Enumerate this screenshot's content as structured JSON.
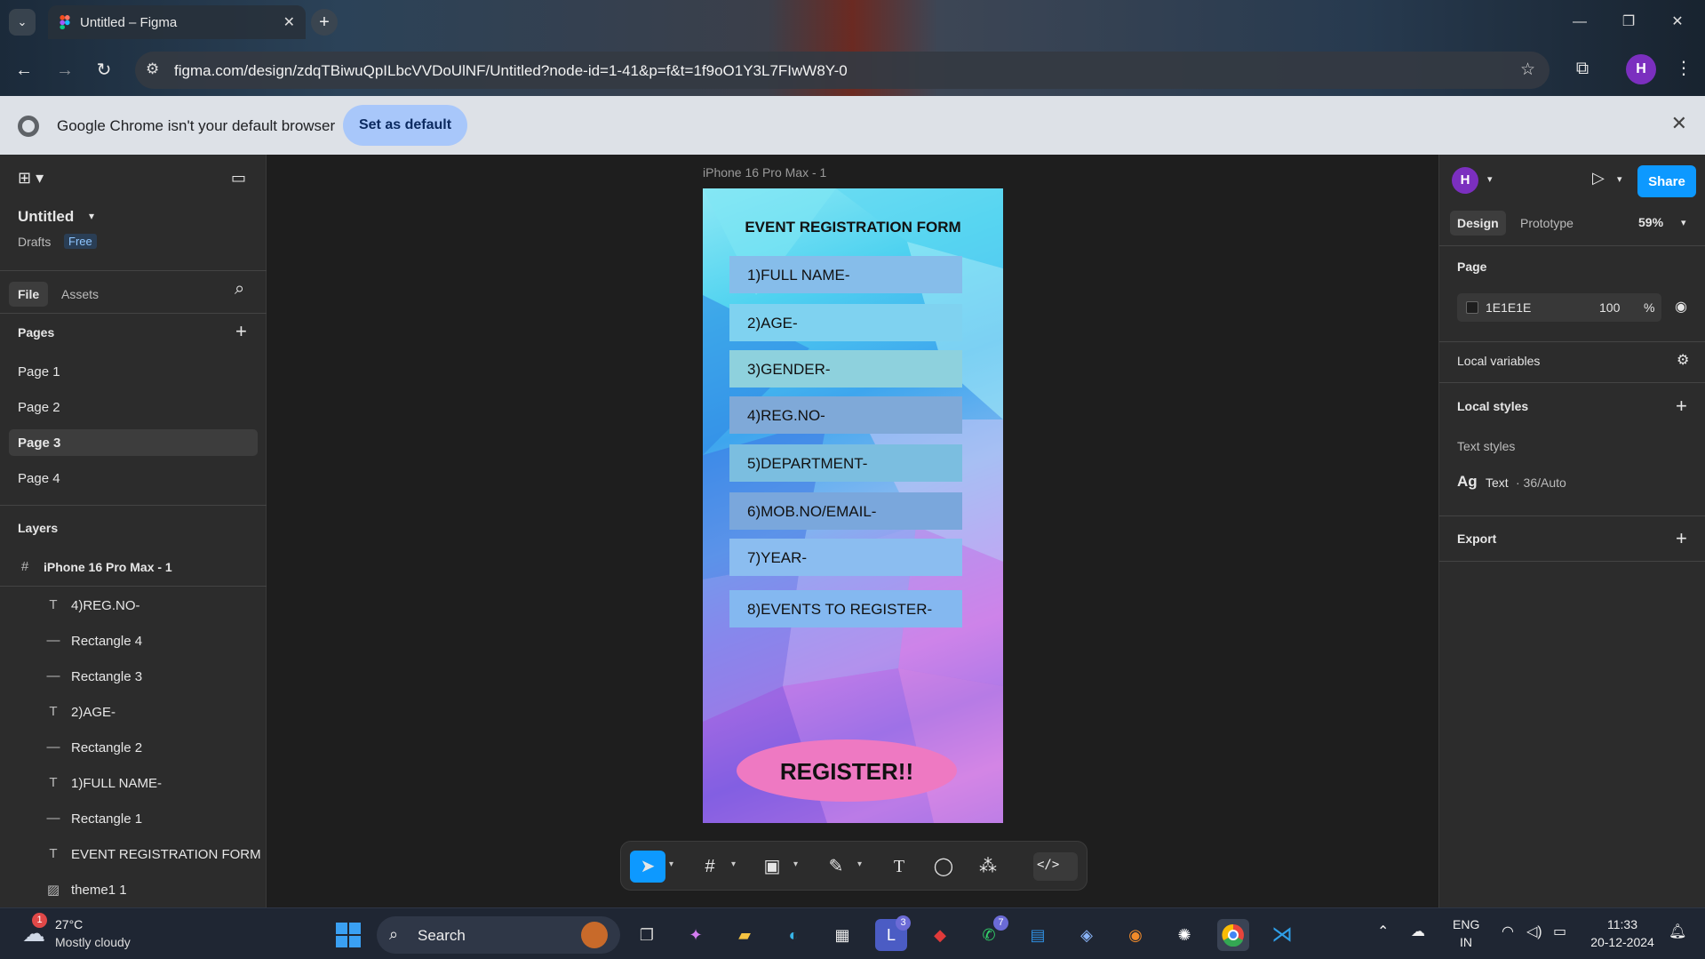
{
  "browser": {
    "tab_title": "Untitled – Figma",
    "url": "figma.com/design/zdqTBiwuQpILbcVVDoUlNF/Untitled?node-id=1-41&p=f&t=1f9oO1Y3L7FIwW8Y-0",
    "profile_initial": "H",
    "infobar_message": "Google Chrome isn't your default browser",
    "infobar_button": "Set as default"
  },
  "left_panel": {
    "file_name": "Untitled",
    "drafts_label": "Drafts",
    "plan_badge": "Free",
    "tabs": [
      "File",
      "Assets"
    ],
    "pages_heading": "Pages",
    "pages": [
      "Page 1",
      "Page 2",
      "Page 3",
      "Page 4"
    ],
    "active_page": "Page 3",
    "layers_heading": "Layers",
    "frame_layer": "iPhone 16 Pro Max - 1",
    "layers": [
      {
        "type": "text",
        "name": "4)REG.NO-"
      },
      {
        "type": "rect",
        "name": "Rectangle 4"
      },
      {
        "type": "rect",
        "name": "Rectangle 3"
      },
      {
        "type": "text",
        "name": "2)AGE-"
      },
      {
        "type": "rect",
        "name": "Rectangle 2"
      },
      {
        "type": "text",
        "name": "1)FULL NAME-"
      },
      {
        "type": "rect",
        "name": "Rectangle 1"
      },
      {
        "type": "text",
        "name": "EVENT REGISTRATION FORM"
      },
      {
        "type": "image",
        "name": "theme1 1"
      }
    ]
  },
  "canvas": {
    "frame_label": "iPhone 16 Pro Max - 1",
    "form_title": "EVENT REGISTRATION FORM",
    "fields": [
      "1)FULL NAME-",
      "2)AGE-",
      "3)GENDER-",
      "4)REG.NO-",
      "5)DEPARTMENT-",
      "6)MOB.NO/EMAIL-",
      "7)YEAR-",
      "8)EVENTS TO REGISTER-"
    ],
    "register_button": "REGISTER!!"
  },
  "right_panel": {
    "user_initial": "H",
    "share_button": "Share",
    "tabs": [
      "Design",
      "Prototype"
    ],
    "zoom": "59%",
    "page_heading": "Page",
    "page_color": "1E1E1E",
    "page_opacity": "100",
    "percent_sign": "%",
    "local_variables": "Local variables",
    "local_styles": "Local styles",
    "text_styles_heading": "Text styles",
    "text_style_sample": "Ag",
    "text_style_name": "Text",
    "text_style_spec": "· 36/Auto",
    "export_heading": "Export"
  },
  "help_label": "?",
  "taskbar": {
    "weather_temp": "27°C",
    "weather_desc": "Mostly cloudy",
    "weather_badge": "1",
    "search_label": "Search",
    "teams_badge": "3",
    "whatsapp_badge": "7",
    "lang_top": "ENG",
    "lang_bottom": "IN",
    "time": "11:33",
    "date": "20-12-2024"
  }
}
